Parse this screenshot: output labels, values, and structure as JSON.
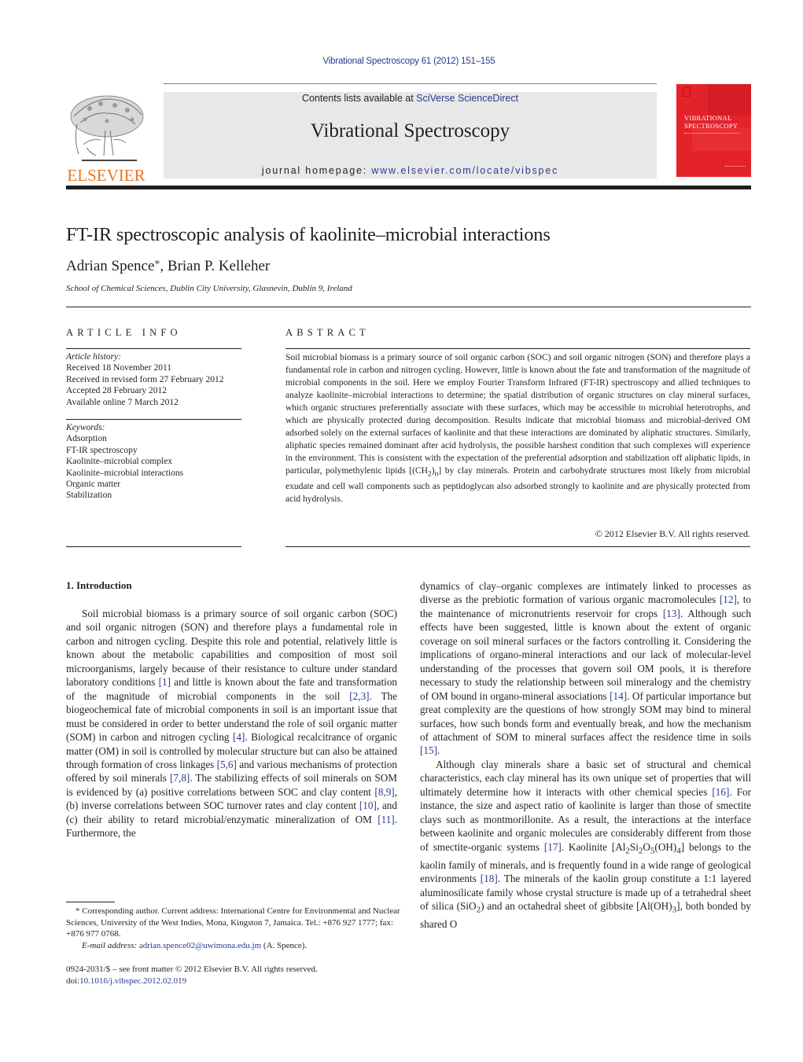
{
  "header": {
    "journal_ref": "Vibrational Spectroscopy 61 (2012) 151–155",
    "contents_prefix": "Contents lists available at ",
    "contents_link": "SciVerse ScienceDirect",
    "journal_title": "Vibrational Spectroscopy",
    "homepage_prefix": "journal homepage: ",
    "homepage_link": "www.elsevier.com/locate/vibspec",
    "publisher_logo_text": "ELSEVIER",
    "cover_title_line1": "VIBRATIONAL",
    "cover_title_line2": "SPECTROSCOPY",
    "colors": {
      "link": "#2a3a8c",
      "elsevier_orange": "#e87722",
      "cover_red": "#e4222a",
      "banner_gray": "#e8e8e9"
    }
  },
  "article": {
    "title": "FT-IR spectroscopic analysis of kaolinite–microbial interactions",
    "author1": "Adrian Spence",
    "author1_mark": "*",
    "author_sep": ", ",
    "author2": "Brian P. Kelleher",
    "affiliation": "School of Chemical Sciences, Dublin City University, Glasnevin, Dublin 9, Ireland"
  },
  "article_info": {
    "label": "ARTICLE INFO",
    "history_heading": "Article history:",
    "history": [
      "Received 18 November 2011",
      "Received in revised form 27 February 2012",
      "Accepted 28 February 2012",
      "Available online 7 March 2012"
    ],
    "keywords_heading": "Keywords:",
    "keywords": [
      "Adsorption",
      "FT-IR spectroscopy",
      "Kaolinite–microbial complex",
      "Kaolinite–microbial interactions",
      "Organic matter",
      "Stabilization"
    ]
  },
  "abstract": {
    "label": "ABSTRACT",
    "text_a": "Soil microbial biomass is a primary source of soil organic carbon (SOC) and soil organic nitrogen (SON) and therefore plays a fundamental role in carbon and nitrogen cycling. However, little is known about the fate and transformation of the magnitude of microbial components in the soil. Here we employ Fourier Transform Infrared (FT-IR) spectroscopy and allied techniques to analyze kaolinite–microbial interactions to determine; the spatial distribution of organic structures on clay mineral surfaces, which organic structures preferentially associate with these surfaces, which may be accessible to microbial heterotrophs, and which are physically protected during decomposition. Results indicate that microbial biomass and microbial-derived OM adsorbed solely on the external surfaces of kaolinite and that these interactions are dominated by aliphatic structures. Similarly, aliphatic species remained dominant after acid hydrolysis, the possible harshest condition that such complexes will experience in the environment. This is consistent with the expectation of the preferential adsorption and stabilization off aliphatic lipids, in particular, polymethylenic lipids [(CH",
    "sub_2": "2",
    "text_b": ")",
    "sub_n": "n",
    "text_c": "] by clay minerals. Protein and carbohydrate structures most likely from microbial exudate and cell wall components such as peptidoglycan also adsorbed strongly to kaolinite and are physically protected from acid hydrolysis.",
    "copyright": "© 2012 Elsevier B.V. All rights reserved."
  },
  "intro": {
    "heading": "1.  Introduction",
    "left": [
      {
        "t": "Soil microbial biomass is a primary source of soil organic carbon (SOC) and soil organic nitrogen (SON) and therefore plays a fundamental role in carbon and nitrogen cycling. Despite this role and potential, relatively little is known about the metabolic capabilities and composition of most soil microorganisms, largely because of their resistance to culture under standard laboratory conditions "
      },
      {
        "c": "[1]"
      },
      {
        "t": " and little is known about the fate and transformation of the magnitude of microbial components in the soil "
      },
      {
        "c": "[2,3]"
      },
      {
        "t": ". The biogeochemical fate of microbial components in soil is an important issue that must be considered in order to better understand the role of soil organic matter (SOM) in carbon and nitrogen cycling "
      },
      {
        "c": "[4]"
      },
      {
        "t": ". Biological recalcitrance of organic matter (OM) in soil is controlled by molecular structure but can also be attained through formation of cross linkages "
      },
      {
        "c": "[5,6]"
      },
      {
        "t": " and various mechanisms of protection offered by soil minerals "
      },
      {
        "c": "[7,8]"
      },
      {
        "t": ". The stabilizing effects of soil minerals on SOM is evidenced by (a) positive correlations between SOC and clay content "
      },
      {
        "c": "[8,9]"
      },
      {
        "t": ", (b) inverse correlations between SOC turnover rates and clay content "
      },
      {
        "c": "[10]"
      },
      {
        "t": ", and (c) their ability to retard microbial/enzymatic mineralization of OM "
      },
      {
        "c": "[11]"
      },
      {
        "t": ". Furthermore, the"
      }
    ],
    "right_p1": [
      {
        "t": "dynamics of clay–organic complexes are intimately linked to processes as diverse as the prebiotic formation of various organic macromolecules "
      },
      {
        "c": "[12]"
      },
      {
        "t": ", to the maintenance of micronutrients reservoir for crops "
      },
      {
        "c": "[13]"
      },
      {
        "t": ". Although such effects have been suggested, little is known about the extent of organic coverage on soil mineral surfaces or the factors controlling it. Considering the implications of organo-mineral interactions and our lack of molecular-level understanding of the processes that govern soil OM pools, it is therefore necessary to study the relationship between soil mineralogy and the chemistry of OM bound in organo-mineral associations "
      },
      {
        "c": "[14]"
      },
      {
        "t": ". Of particular importance but great complexity are the questions of how strongly SOM may bind to mineral surfaces, how such bonds form and eventually break, and how the mechanism of attachment of SOM to mineral surfaces affect the residence time in soils "
      },
      {
        "c": "[15]"
      },
      {
        "t": "."
      }
    ],
    "right_p2": [
      {
        "t": "Although clay minerals share a basic set of structural and chemical characteristics, each clay mineral has its own unique set of properties that will ultimately determine how it interacts with other chemical species "
      },
      {
        "c": "[16]"
      },
      {
        "t": ". For instance, the size and aspect ratio of kaolinite is larger than those of smectite clays such as montmorillonite. As a result, the interactions at the interface between kaolinite and organic molecules are considerably different from those of smectite-organic systems "
      },
      {
        "c": "[17]"
      },
      {
        "t": ". Kaolinite [Al"
      },
      {
        "s": "2"
      },
      {
        "t": "Si"
      },
      {
        "s": "2"
      },
      {
        "t": "O"
      },
      {
        "s": "5"
      },
      {
        "t": "(OH)"
      },
      {
        "s": "4"
      },
      {
        "t": "] belongs to the kaolin family of minerals, and is frequently found in a wide range of geological environments "
      },
      {
        "c": "[18]"
      },
      {
        "t": ". The minerals of the kaolin group constitute a 1:1 layered aluminosilicate family whose crystal structure is made up of a tetrahedral sheet of silica (SiO"
      },
      {
        "s": "2"
      },
      {
        "t": ") and an octahedral sheet of gibbsite [Al(OH)"
      },
      {
        "s": "3"
      },
      {
        "t": "], both bonded by shared O"
      }
    ]
  },
  "footnote": {
    "mark": "*",
    "text": " Corresponding author. Current address: International Centre for Environmental and Nuclear Sciences, University of the West Indies, Mona, Kingston 7, Jamaica. Tel.: +876 927 1777; fax: +876 977 0768.",
    "email_label": "E-mail address: ",
    "email": "adrian.spence02@uwimona.edu.jm",
    "email_suffix": " (A. Spence)."
  },
  "front_matter": {
    "issn_line": "0924-2031/$ – see front matter © 2012 Elsevier B.V. All rights reserved.",
    "doi_prefix": "doi:",
    "doi": "10.1016/j.vibspec.2012.02.019"
  }
}
